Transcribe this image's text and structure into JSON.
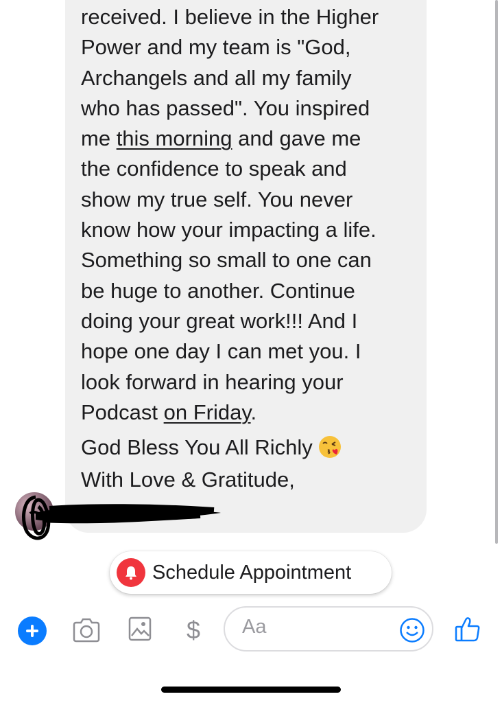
{
  "message": {
    "lines": [
      "received. I believe in the Higher",
      "Power and my team is \"God,",
      "Archangels and all my family",
      "who has passed\". You inspired"
    ],
    "l5_before": "me ",
    "l5_underlined": "this morning",
    "l5_after": " and gave me",
    "lines_after": [
      "the confidence to speak and",
      "show my true self. You never",
      "know how your impacting a life.",
      "Something so small to one can",
      "be huge to another. Continue",
      "doing your great work!!! And I",
      "hope one day I can met you. I",
      "look forward in hearing your"
    ],
    "l14_before": "Podcast ",
    "l14_underlined": "on Friday",
    "l14_after": ".",
    "closing": "God Bless You All Richly",
    "closing_emoji": "kissing-face-icon",
    "signoff": "With Love & Gratitude,"
  },
  "quick_reply": {
    "label": "Schedule Appointment",
    "icon": "bell-icon",
    "icon_bg": "#f0353d"
  },
  "composer": {
    "placeholder": "Aa",
    "dollar": "$",
    "accent": "#0a7cff"
  }
}
